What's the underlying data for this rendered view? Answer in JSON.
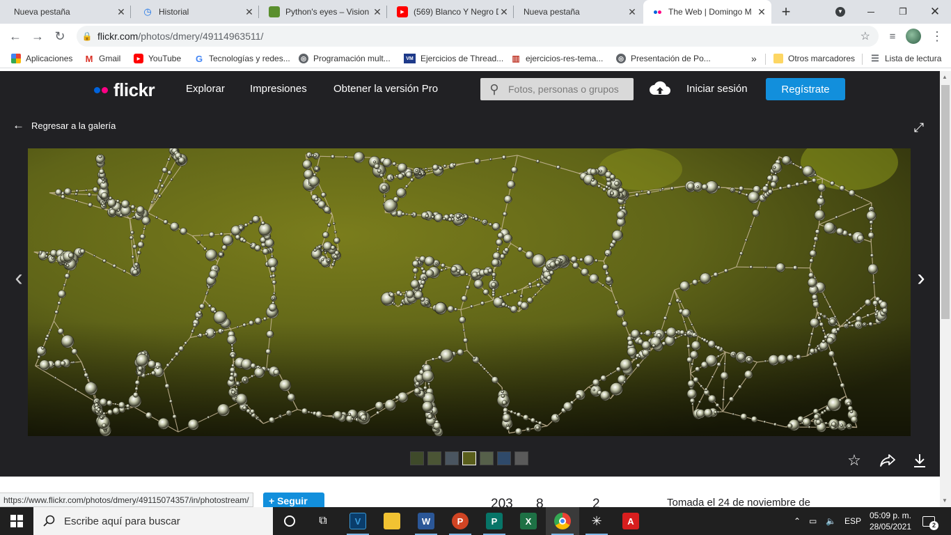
{
  "browser": {
    "tabs": [
      {
        "title": "Nueva pestaña",
        "icon": "none"
      },
      {
        "title": "Historial",
        "icon": "history-icon"
      },
      {
        "title": "Python's eyes – Vision",
        "icon": "python-eyes-favicon"
      },
      {
        "title": "(569) Blanco Y Negro D",
        "icon": "youtube-icon"
      },
      {
        "title": "Nueva pestaña",
        "icon": "none"
      },
      {
        "title": "The Web | Domingo M",
        "icon": "flickr-icon"
      }
    ],
    "url_host": "flickr.com",
    "url_path": "/photos/dmery/49114963511/",
    "bookmarks": [
      {
        "label": "Aplicaciones",
        "icon": "apps-grid-icon"
      },
      {
        "label": "Gmail",
        "icon": "gmail-icon"
      },
      {
        "label": "YouTube",
        "icon": "youtube-icon"
      },
      {
        "label": "Tecnologías y redes...",
        "icon": "google-icon"
      },
      {
        "label": "Programación mult...",
        "icon": "globe-icon"
      },
      {
        "label": "Ejercicios de Thread...",
        "icon": "vm-icon"
      },
      {
        "label": "ejercicios-res-tema...",
        "icon": "chart-icon"
      },
      {
        "label": "Presentación de Po...",
        "icon": "globe-icon"
      }
    ],
    "other_bookmarks": "Otros marcadores",
    "reading_list": "Lista de lectura",
    "more_bookmarks": "»",
    "status_url": "https://www.flickr.com/photos/dmery/49115074357/in/photostream/"
  },
  "flickr": {
    "logo_text": "flickr",
    "nav": [
      "Explorar",
      "Impresiones",
      "Obtener la versión Pro"
    ],
    "search_placeholder": "Fotos, personas o grupos",
    "login": "Iniciar sesión",
    "signup": "Regístrate",
    "back_label": "Regresar a la galería",
    "follow_label": "Seguir",
    "stats": [
      "203",
      "8",
      "2"
    ],
    "taken": "Tomada el 24 de noviembre de",
    "colors": {
      "blue": "#128fdc",
      "pink": "#ff0084",
      "dark": "#212124"
    }
  },
  "taskbar": {
    "search_text": "Escribe aquí para buscar",
    "language": "ESP",
    "time": "05:09 p. m.",
    "date": "28/05/2021",
    "notifications": "2"
  }
}
